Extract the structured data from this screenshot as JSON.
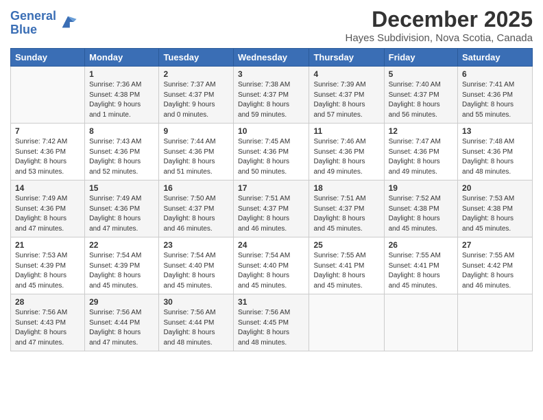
{
  "header": {
    "logo_line1": "General",
    "logo_line2": "Blue",
    "month": "December 2025",
    "location": "Hayes Subdivision, Nova Scotia, Canada"
  },
  "days_of_week": [
    "Sunday",
    "Monday",
    "Tuesday",
    "Wednesday",
    "Thursday",
    "Friday",
    "Saturday"
  ],
  "weeks": [
    [
      {
        "day": "",
        "info": ""
      },
      {
        "day": "1",
        "info": "Sunrise: 7:36 AM\nSunset: 4:38 PM\nDaylight: 9 hours\nand 1 minute."
      },
      {
        "day": "2",
        "info": "Sunrise: 7:37 AM\nSunset: 4:37 PM\nDaylight: 9 hours\nand 0 minutes."
      },
      {
        "day": "3",
        "info": "Sunrise: 7:38 AM\nSunset: 4:37 PM\nDaylight: 8 hours\nand 59 minutes."
      },
      {
        "day": "4",
        "info": "Sunrise: 7:39 AM\nSunset: 4:37 PM\nDaylight: 8 hours\nand 57 minutes."
      },
      {
        "day": "5",
        "info": "Sunrise: 7:40 AM\nSunset: 4:37 PM\nDaylight: 8 hours\nand 56 minutes."
      },
      {
        "day": "6",
        "info": "Sunrise: 7:41 AM\nSunset: 4:36 PM\nDaylight: 8 hours\nand 55 minutes."
      }
    ],
    [
      {
        "day": "7",
        "info": "Sunrise: 7:42 AM\nSunset: 4:36 PM\nDaylight: 8 hours\nand 53 minutes."
      },
      {
        "day": "8",
        "info": "Sunrise: 7:43 AM\nSunset: 4:36 PM\nDaylight: 8 hours\nand 52 minutes."
      },
      {
        "day": "9",
        "info": "Sunrise: 7:44 AM\nSunset: 4:36 PM\nDaylight: 8 hours\nand 51 minutes."
      },
      {
        "day": "10",
        "info": "Sunrise: 7:45 AM\nSunset: 4:36 PM\nDaylight: 8 hours\nand 50 minutes."
      },
      {
        "day": "11",
        "info": "Sunrise: 7:46 AM\nSunset: 4:36 PM\nDaylight: 8 hours\nand 49 minutes."
      },
      {
        "day": "12",
        "info": "Sunrise: 7:47 AM\nSunset: 4:36 PM\nDaylight: 8 hours\nand 49 minutes."
      },
      {
        "day": "13",
        "info": "Sunrise: 7:48 AM\nSunset: 4:36 PM\nDaylight: 8 hours\nand 48 minutes."
      }
    ],
    [
      {
        "day": "14",
        "info": "Sunrise: 7:49 AM\nSunset: 4:36 PM\nDaylight: 8 hours\nand 47 minutes."
      },
      {
        "day": "15",
        "info": "Sunrise: 7:49 AM\nSunset: 4:36 PM\nDaylight: 8 hours\nand 47 minutes."
      },
      {
        "day": "16",
        "info": "Sunrise: 7:50 AM\nSunset: 4:37 PM\nDaylight: 8 hours\nand 46 minutes."
      },
      {
        "day": "17",
        "info": "Sunrise: 7:51 AM\nSunset: 4:37 PM\nDaylight: 8 hours\nand 46 minutes."
      },
      {
        "day": "18",
        "info": "Sunrise: 7:51 AM\nSunset: 4:37 PM\nDaylight: 8 hours\nand 45 minutes."
      },
      {
        "day": "19",
        "info": "Sunrise: 7:52 AM\nSunset: 4:38 PM\nDaylight: 8 hours\nand 45 minutes."
      },
      {
        "day": "20",
        "info": "Sunrise: 7:53 AM\nSunset: 4:38 PM\nDaylight: 8 hours\nand 45 minutes."
      }
    ],
    [
      {
        "day": "21",
        "info": "Sunrise: 7:53 AM\nSunset: 4:39 PM\nDaylight: 8 hours\nand 45 minutes."
      },
      {
        "day": "22",
        "info": "Sunrise: 7:54 AM\nSunset: 4:39 PM\nDaylight: 8 hours\nand 45 minutes."
      },
      {
        "day": "23",
        "info": "Sunrise: 7:54 AM\nSunset: 4:40 PM\nDaylight: 8 hours\nand 45 minutes."
      },
      {
        "day": "24",
        "info": "Sunrise: 7:54 AM\nSunset: 4:40 PM\nDaylight: 8 hours\nand 45 minutes."
      },
      {
        "day": "25",
        "info": "Sunrise: 7:55 AM\nSunset: 4:41 PM\nDaylight: 8 hours\nand 45 minutes."
      },
      {
        "day": "26",
        "info": "Sunrise: 7:55 AM\nSunset: 4:41 PM\nDaylight: 8 hours\nand 45 minutes."
      },
      {
        "day": "27",
        "info": "Sunrise: 7:55 AM\nSunset: 4:42 PM\nDaylight: 8 hours\nand 46 minutes."
      }
    ],
    [
      {
        "day": "28",
        "info": "Sunrise: 7:56 AM\nSunset: 4:43 PM\nDaylight: 8 hours\nand 47 minutes."
      },
      {
        "day": "29",
        "info": "Sunrise: 7:56 AM\nSunset: 4:44 PM\nDaylight: 8 hours\nand 47 minutes."
      },
      {
        "day": "30",
        "info": "Sunrise: 7:56 AM\nSunset: 4:44 PM\nDaylight: 8 hours\nand 48 minutes."
      },
      {
        "day": "31",
        "info": "Sunrise: 7:56 AM\nSunset: 4:45 PM\nDaylight: 8 hours\nand 48 minutes."
      },
      {
        "day": "",
        "info": ""
      },
      {
        "day": "",
        "info": ""
      },
      {
        "day": "",
        "info": ""
      }
    ]
  ]
}
